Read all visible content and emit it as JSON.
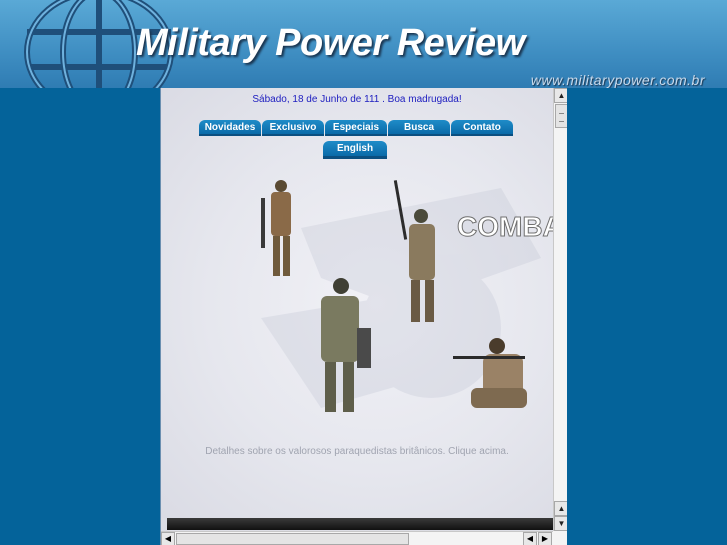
{
  "header": {
    "title": "Military Power Review",
    "url": "www.militarypower.com.br"
  },
  "greeting": "Sábado, 18 de Junho de 111 . Boa madrugada!",
  "nav": {
    "items": [
      "Novidades",
      "Exclusivo",
      "Especiais",
      "Busca",
      "Contato"
    ],
    "english": "English"
  },
  "promo": {
    "overlay_text": "COMBA",
    "caption": "Detalhes sobre os valorosos paraquedistas britânicos. Clique acima."
  },
  "colors": {
    "page_bg": "#04639a",
    "nav_button": "#0a6aa8",
    "greeting_text": "#2020c0"
  },
  "icons": {
    "scroll_up": "▲",
    "scroll_down": "▼",
    "scroll_left": "◀",
    "scroll_right": "▶"
  }
}
